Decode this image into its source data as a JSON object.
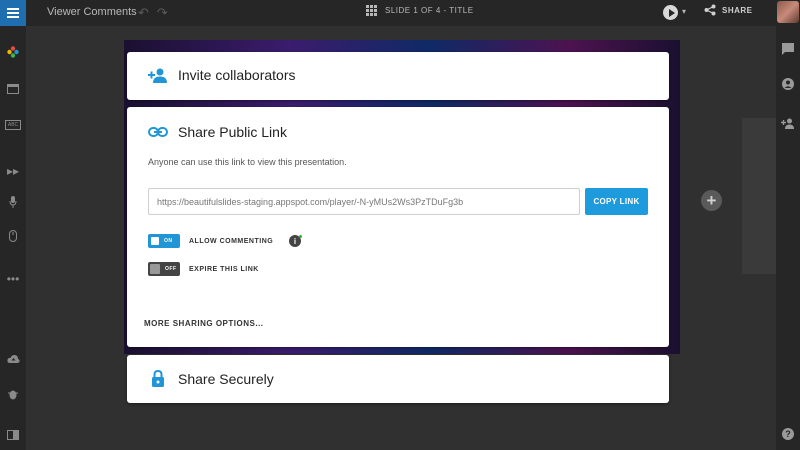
{
  "app": {
    "document_title": "Viewer Comments",
    "slide_indicator": "SLIDE 1 OF 4 - TITLE",
    "share_label": "SHARE"
  },
  "icons": {
    "menu": "hamburger-icon",
    "undo": "undo-icon",
    "redo": "redo-icon",
    "grid": "grid-icon",
    "play": "play-icon",
    "share": "share-icon",
    "add_user": "add-user-icon",
    "link": "link-icon",
    "lock": "lock-icon",
    "info": "info-icon"
  },
  "left_sidebar": {
    "text_icon_label": "ABC"
  },
  "dialog": {
    "invite": {
      "title": "Invite collaborators"
    },
    "public_link": {
      "title": "Share Public Link",
      "description": "Anyone can use this link to view this presentation.",
      "url": "https://beautifulslides-staging.appspot.com/player/-N-yMUs2Ws3PzTDuFg3b",
      "copy_button": "COPY LINK",
      "allow_commenting": {
        "label": "ALLOW COMMENTING",
        "state": "ON",
        "enabled": true
      },
      "expire_link": {
        "label": "EXPIRE THIS LINK",
        "state": "OFF",
        "enabled": false
      },
      "more_options": "MORE SHARING OPTIONS..."
    },
    "secure": {
      "title": "Share Securely"
    }
  },
  "colors": {
    "accent": "#1e9bdc",
    "chrome": "#262626",
    "status_dot": "#2db52d"
  }
}
